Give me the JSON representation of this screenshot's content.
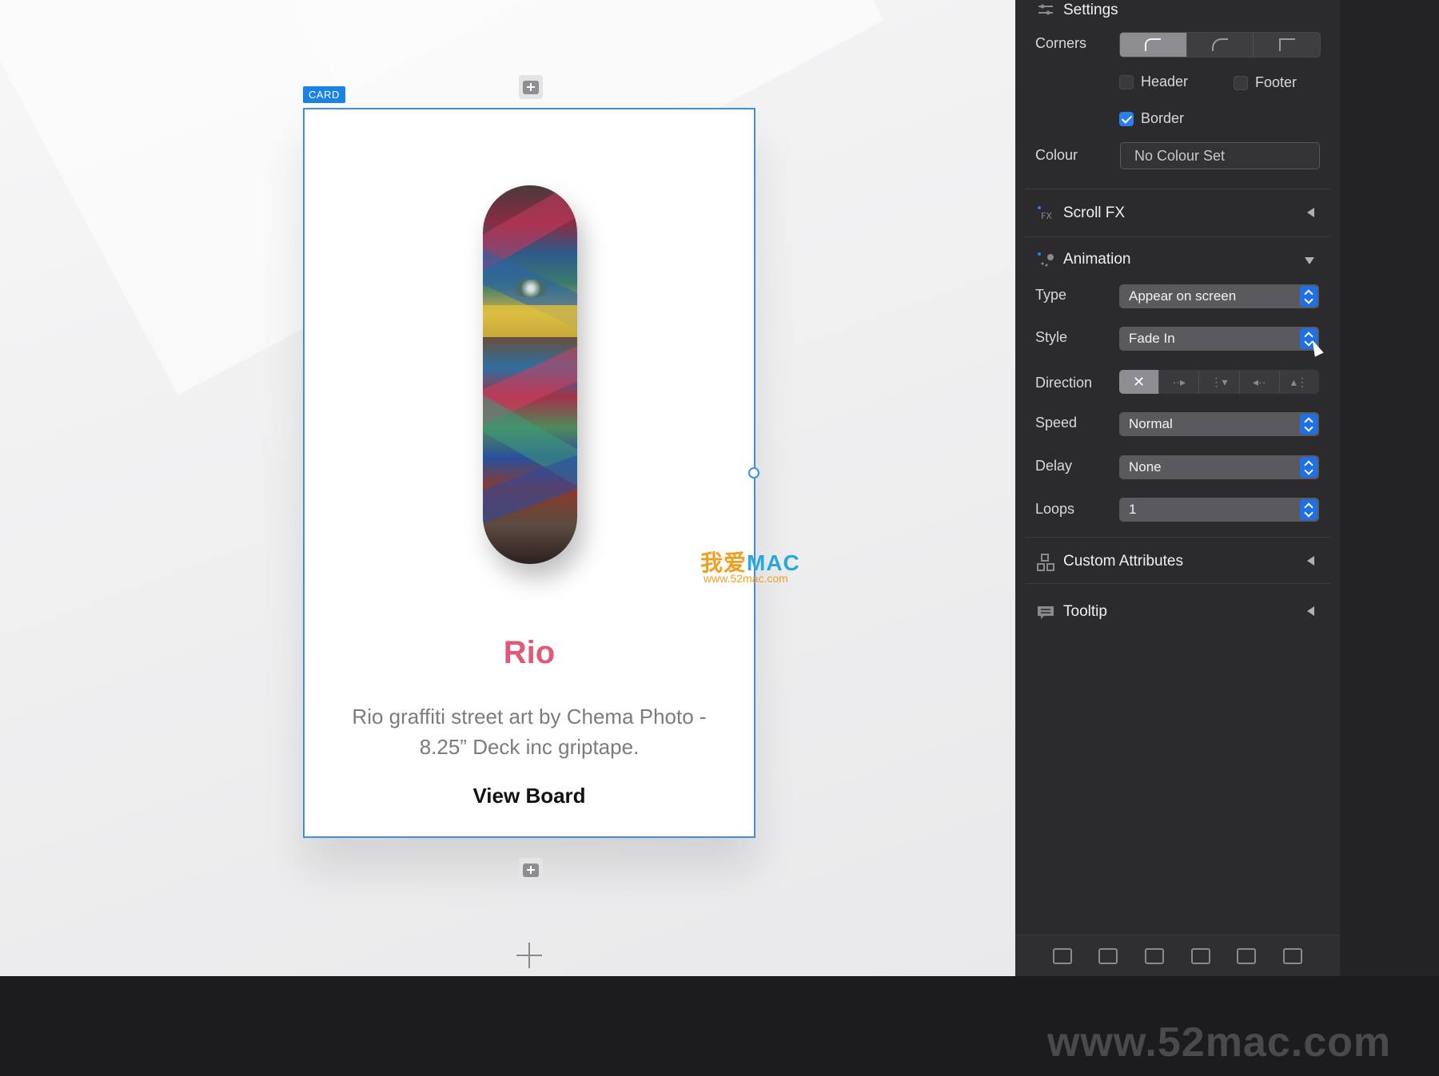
{
  "canvas": {
    "card_tag": "CARD",
    "card": {
      "title": "Rio",
      "description": "Rio graffiti street art by Chema Photo - 8.25” Deck inc griptape.",
      "link": "View Board"
    },
    "watermark": {
      "cn": "我爱",
      "mac": "MAC",
      "url": "www.52mac.com"
    }
  },
  "inspector": {
    "settings": {
      "title": "Settings",
      "corners_label": "Corners",
      "header_label": "Header",
      "footer_label": "Footer",
      "border_label": "Border",
      "header_checked": false,
      "footer_checked": false,
      "border_checked": true,
      "colour_label": "Colour",
      "colour_value": "No Colour Set"
    },
    "scroll_fx": {
      "title": "Scroll FX"
    },
    "animation": {
      "title": "Animation",
      "type_label": "Type",
      "type_value": "Appear on screen",
      "style_label": "Style",
      "style_value": "Fade In",
      "direction_label": "Direction",
      "direction_options": [
        "✕",
        "··▸",
        "⋮▾",
        "◂··",
        "▴⋮"
      ],
      "speed_label": "Speed",
      "speed_value": "Normal",
      "delay_label": "Delay",
      "delay_value": "None",
      "loops_label": "Loops",
      "loops_value": "1"
    },
    "custom_attributes": {
      "title": "Custom Attributes"
    },
    "tooltip": {
      "title": "Tooltip"
    }
  },
  "footer": {
    "watermark": "www.52mac.com"
  },
  "colors": {
    "accent": "#1b82e6",
    "title_pink": "#e05a78",
    "stepper_blue": "#1f6fe6"
  }
}
